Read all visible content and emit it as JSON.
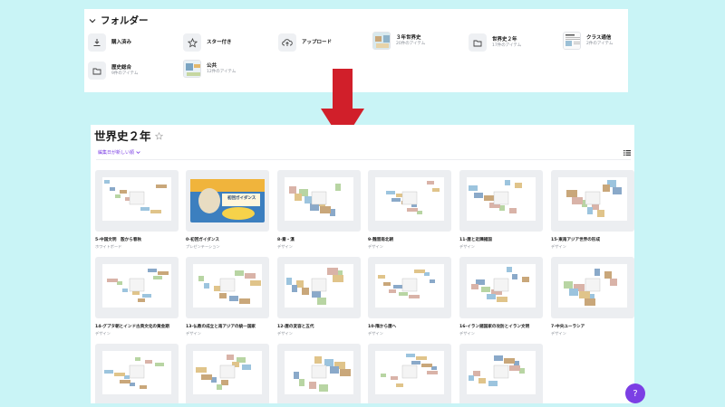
{
  "folders": {
    "title": "フォルダー",
    "items": [
      {
        "name": "購入済み",
        "sub": "",
        "icon": "download-icon"
      },
      {
        "name": "スター付き",
        "sub": "",
        "icon": "star-icon"
      },
      {
        "name": "アップロード",
        "sub": "",
        "icon": "upload-cloud-icon"
      },
      {
        "name": "３年世界史",
        "sub": "20件のアイテム",
        "icon": "thumbnail"
      },
      {
        "name": "世界史２年",
        "sub": "17件のアイテム",
        "icon": "folder-icon"
      },
      {
        "name": "クラス通信",
        "sub": "2件のアイテム",
        "icon": "thumbnail"
      },
      {
        "name": "歴史総合",
        "sub": "9件のアイテム",
        "icon": "folder-icon"
      },
      {
        "name": "公共",
        "sub": "12件のアイテム",
        "icon": "thumbnail"
      }
    ]
  },
  "main": {
    "title": "世界史２年",
    "sort_label": "編集日が新しい順"
  },
  "designs": [
    {
      "name": "5-中国文明　殷から春秋",
      "type": "ホワイトボード"
    },
    {
      "name": "0-初回ガイダンス",
      "type": "プレゼンテーション",
      "thumb_title": "初回ガイダンス"
    },
    {
      "name": "8-秦・漢",
      "type": "デザイン"
    },
    {
      "name": "9-魏晋南北朝",
      "type": "デザイン"
    },
    {
      "name": "11-唐と近隣諸国",
      "type": "デザイン"
    },
    {
      "name": "15-東南アジア世界の形成",
      "type": "デザイン"
    },
    {
      "name": "14-グプタ朝とインド古典文化の黄金期",
      "type": "デザイン"
    },
    {
      "name": "13-仏教の成立と南アジアの統一国家",
      "type": "デザイン"
    },
    {
      "name": "12-唐の変容と五代",
      "type": "デザイン"
    },
    {
      "name": "10-隋から唐へ",
      "type": "デザイン"
    },
    {
      "name": "16-イラン諸国家の攻防とイラン文明",
      "type": "デザイン"
    },
    {
      "name": "7-中央ユーラシア",
      "type": "デザイン"
    },
    {
      "name": "",
      "type": ""
    },
    {
      "name": "",
      "type": ""
    },
    {
      "name": "",
      "type": ""
    },
    {
      "name": "",
      "type": ""
    },
    {
      "name": "",
      "type": ""
    }
  ],
  "colors": {
    "background": "#c9f4f6",
    "arrow": "#d11f2a",
    "accent": "#7b3fe4"
  }
}
